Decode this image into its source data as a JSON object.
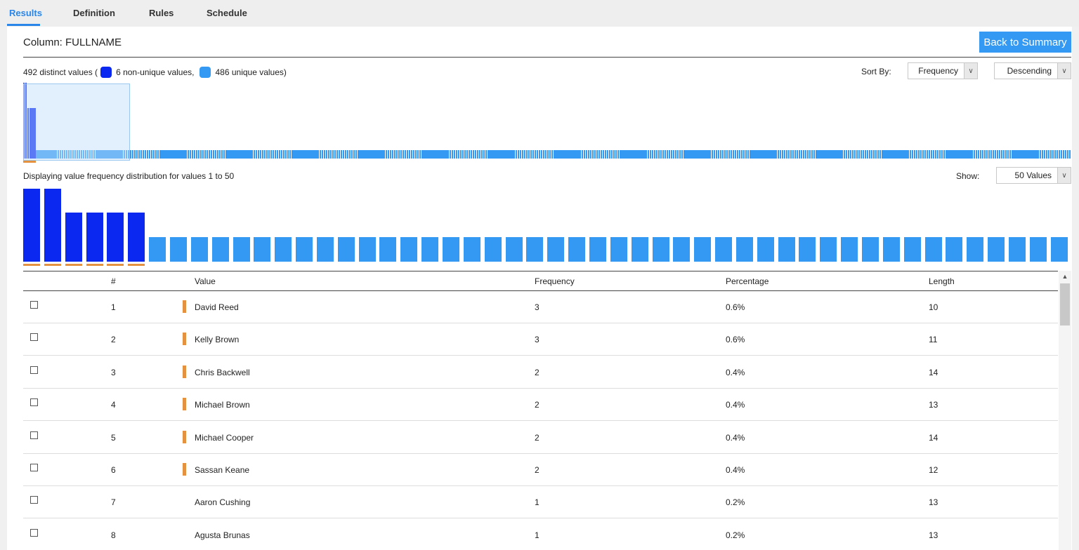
{
  "tabs": [
    {
      "label": "Results",
      "active": true
    },
    {
      "label": "Definition",
      "active": false
    },
    {
      "label": "Rules",
      "active": false
    },
    {
      "label": "Schedule",
      "active": false
    }
  ],
  "header": {
    "column_title": "Column: FULLNAME",
    "back_button": "Back to Summary"
  },
  "summary": {
    "distinct_text": "492 distinct values (",
    "non_unique_text": "6 non-unique values,",
    "unique_text": "486 unique values)"
  },
  "sort": {
    "label": "Sort By:",
    "field": "Frequency",
    "order": "Descending"
  },
  "display": {
    "text": "Displaying value frequency distribution for values 1 to 50",
    "show_label": "Show:",
    "show_value": "50 Values"
  },
  "colors": {
    "non_unique": "#0a28f0",
    "unique": "#3399f3",
    "duplicate_marker": "#e49240",
    "accent": "#2a86e8"
  },
  "chart_data": {
    "type": "bar",
    "distinct_values": 492,
    "non_unique_count": 6,
    "unique_count": 486,
    "frequencies_first_50": [
      3,
      3,
      2,
      2,
      2,
      2,
      1,
      1,
      1,
      1,
      1,
      1,
      1,
      1,
      1,
      1,
      1,
      1,
      1,
      1,
      1,
      1,
      1,
      1,
      1,
      1,
      1,
      1,
      1,
      1,
      1,
      1,
      1,
      1,
      1,
      1,
      1,
      1,
      1,
      1,
      1,
      1,
      1,
      1,
      1,
      1,
      1,
      1,
      1,
      1
    ],
    "series": [
      {
        "name": "non-unique values",
        "color": "#0a28f0"
      },
      {
        "name": "unique values",
        "color": "#3399f3"
      }
    ]
  },
  "table": {
    "headers": {
      "num": "#",
      "value": "Value",
      "frequency": "Frequency",
      "percentage": "Percentage",
      "length": "Length"
    },
    "rows": [
      {
        "num": "1",
        "value": "David Reed",
        "frequency": "3",
        "percentage": "0.6%",
        "length": "10",
        "duplicate": true
      },
      {
        "num": "2",
        "value": "Kelly Brown",
        "frequency": "3",
        "percentage": "0.6%",
        "length": "11",
        "duplicate": true
      },
      {
        "num": "3",
        "value": "Chris Backwell",
        "frequency": "2",
        "percentage": "0.4%",
        "length": "14",
        "duplicate": true
      },
      {
        "num": "4",
        "value": "Michael Brown",
        "frequency": "2",
        "percentage": "0.4%",
        "length": "13",
        "duplicate": true
      },
      {
        "num": "5",
        "value": "Michael Cooper",
        "frequency": "2",
        "percentage": "0.4%",
        "length": "14",
        "duplicate": true
      },
      {
        "num": "6",
        "value": "Sassan Keane",
        "frequency": "2",
        "percentage": "0.4%",
        "length": "12",
        "duplicate": true
      },
      {
        "num": "7",
        "value": "Aaron Cushing",
        "frequency": "1",
        "percentage": "0.2%",
        "length": "13",
        "duplicate": false
      },
      {
        "num": "8",
        "value": "Agusta Brunas",
        "frequency": "1",
        "percentage": "0.2%",
        "length": "13",
        "duplicate": false
      }
    ]
  }
}
